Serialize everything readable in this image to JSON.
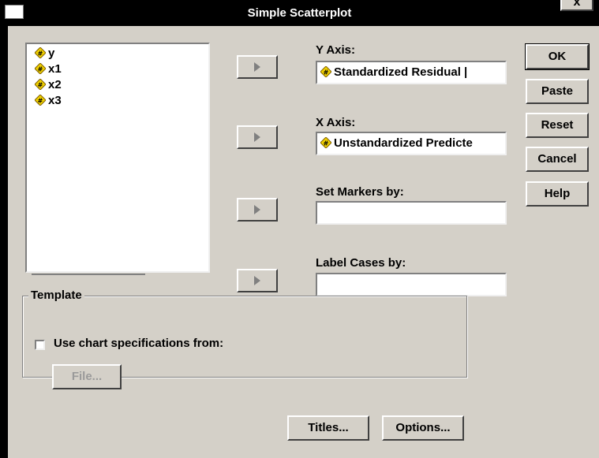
{
  "window": {
    "title": "Simple Scatterplot",
    "close_label": "x"
  },
  "variables": [
    {
      "name": "y",
      "icon": "scale-variable-icon"
    },
    {
      "name": "x1",
      "icon": "scale-variable-icon"
    },
    {
      "name": "x2",
      "icon": "scale-variable-icon"
    },
    {
      "name": "x3",
      "icon": "scale-variable-icon"
    }
  ],
  "y_axis": {
    "label": "Y Axis:",
    "value": "Standardized Residual |"
  },
  "x_axis": {
    "label": "X Axis:",
    "value": "Unstandardized Predicte"
  },
  "set_markers": {
    "label": "Set Markers by:",
    "value": ""
  },
  "label_cases": {
    "label": "Label Cases by:",
    "value": ""
  },
  "side_buttons": {
    "ok": "OK",
    "paste": "Paste",
    "reset": "Reset",
    "cancel": "Cancel",
    "help": "Help"
  },
  "template": {
    "title": "Template",
    "checkbox_label": "Use chart specifications from:",
    "checked": false,
    "file_button": "File..."
  },
  "bottom_buttons": {
    "titles": "Titles...",
    "options": "Options..."
  },
  "colors": {
    "dialog_bg": "#d4d0c8",
    "titlebar_bg": "#000000",
    "icon_fill": "#f0d000"
  }
}
